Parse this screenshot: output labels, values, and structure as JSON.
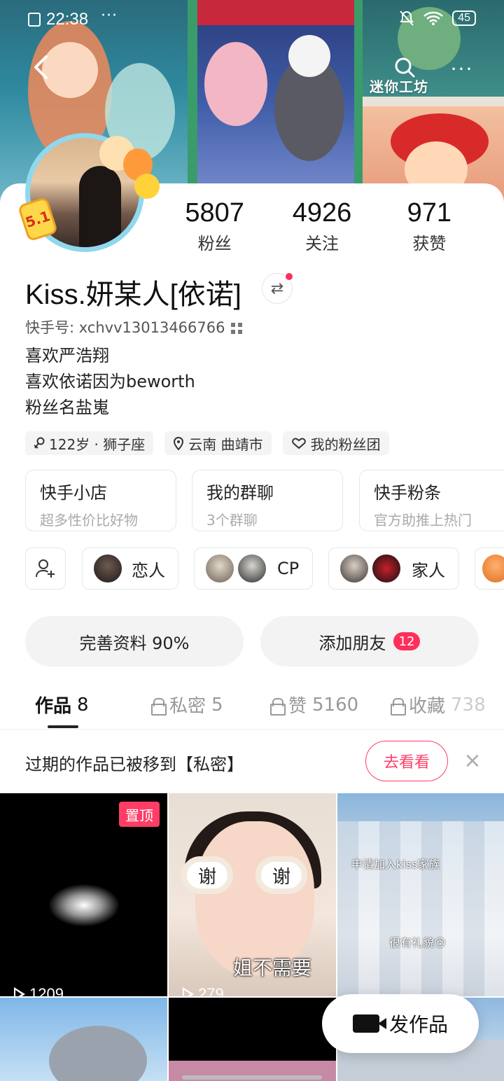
{
  "status_bar": {
    "time": "22:38",
    "dots": "···",
    "battery": "45"
  },
  "banner": {
    "label_mini_workshop": "迷你工坊"
  },
  "header": {
    "back_label": "‹",
    "more_label": "···"
  },
  "avatar": {
    "badge": "5.1"
  },
  "stats": [
    {
      "value": "5807",
      "label": "粉丝"
    },
    {
      "value": "4926",
      "label": "关注"
    },
    {
      "value": "971",
      "label": "获赞"
    }
  ],
  "profile": {
    "nickname": "Kiss.妍某人[依诺]",
    "switch_icon": "⇄",
    "kuaishou_id": "快手号: xchvv13013466766",
    "bio": [
      "喜欢严浩翔",
      "喜欢依诺因为beworth",
      "粉丝名盐嵬"
    ]
  },
  "tags": [
    {
      "icon": "gender-icon",
      "text": "122岁 · 狮子座"
    },
    {
      "icon": "location-icon",
      "text": "云南 曲靖市"
    },
    {
      "icon": "fan-group-icon",
      "text": "我的粉丝团"
    }
  ],
  "services": [
    {
      "title": "快手小店",
      "sub": "超多性价比好物"
    },
    {
      "title": "我的群聊",
      "sub": "3个群聊"
    },
    {
      "title": "快手粉条",
      "sub": "官方助推上热门"
    }
  ],
  "relations": [
    {
      "label": "恋人"
    },
    {
      "label": "CP"
    },
    {
      "label": "家人"
    }
  ],
  "actions": {
    "complete_profile": "完善资料 90%",
    "add_friends": "添加朋友",
    "add_friends_badge": "12"
  },
  "tabs": [
    {
      "label": "作品",
      "count": "8"
    },
    {
      "label": "私密",
      "count": "5"
    },
    {
      "label": "赞",
      "count": "5160"
    },
    {
      "label": "收藏",
      "count": "738"
    }
  ],
  "notice": {
    "text": "过期的作品已被移到【私密】",
    "button": "去看看",
    "close": "×"
  },
  "videos": [
    {
      "pinned": "置顶",
      "plays": "1209"
    },
    {
      "overlay_left": "谢",
      "overlay_right": "谢",
      "caption": "姐不需要",
      "plays": "279"
    },
    {
      "caption_top": "申请加入kiss家族",
      "caption_mid": "很有礼貌😚"
    }
  ],
  "fab": {
    "label": "发作品"
  }
}
